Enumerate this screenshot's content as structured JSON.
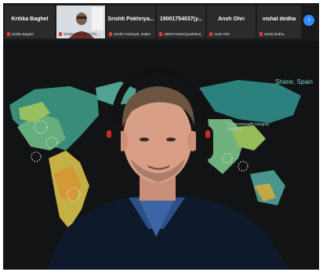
{
  "participants": [
    {
      "name": "Kritika Baghel",
      "sub": "Kritika Baghel"
    },
    {
      "name": "",
      "sub": "Shalini Rao (INTC/C)..."
    },
    {
      "name": "Srishti Pokhriya...",
      "sub": "Srishti Pokhriyal, Intake"
    },
    {
      "name": "19001754037(y...",
      "sub": "19001754037(yash60u)"
    },
    {
      "name": "Ansh Ohri",
      "sub": "Ansh Ohri"
    },
    {
      "name": "vishal dedha",
      "sub": "vishal dedha"
    }
  ],
  "speaker_label": "Shane, Spain",
  "logo_text": "Commonwealth Integrity Tracking",
  "icons": {
    "next": "chevron-right-icon",
    "mic": "mic-muted-icon"
  },
  "colors": {
    "accent": "#2d8cff",
    "mic_muted": "#e03b3b",
    "speaker_label": "#7fd4cf"
  }
}
